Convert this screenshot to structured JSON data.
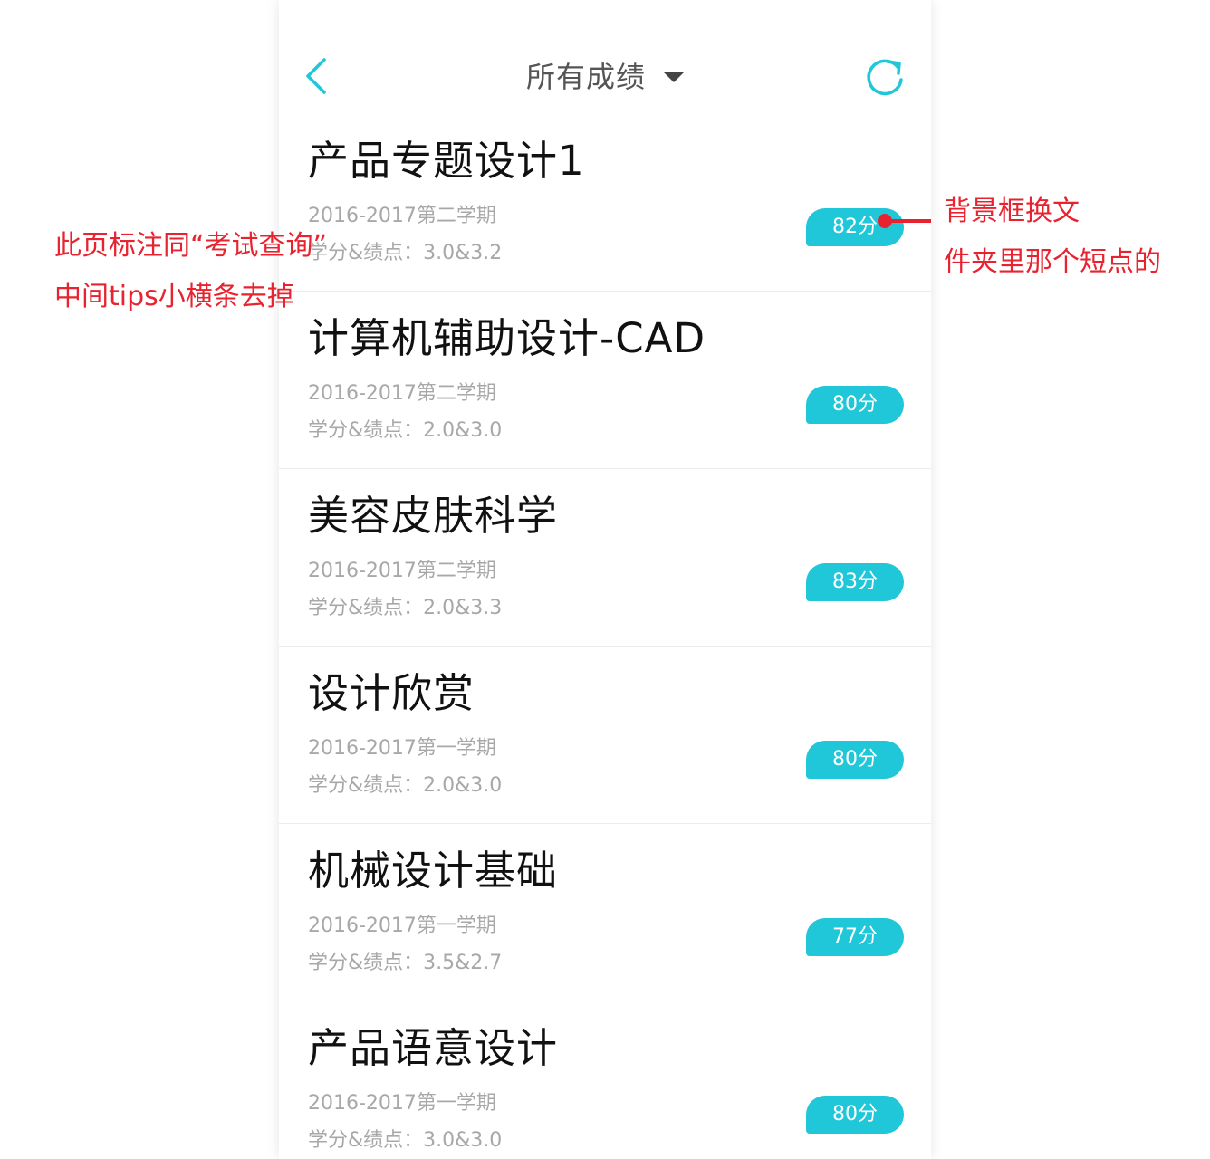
{
  "header": {
    "title": "所有成绩",
    "back_icon": "chevron-left-icon",
    "refresh_icon": "refresh-icon",
    "accent_color": "#1fc7d8"
  },
  "courses": [
    {
      "name": "产品专题设计1",
      "term": "2016-2017第二学期",
      "credit_label": "学分&绩点：",
      "credit_value": "3.0&3.2",
      "score": "82分"
    },
    {
      "name": "计算机辅助设计-CAD",
      "term": "2016-2017第二学期",
      "credit_label": "学分&绩点：",
      "credit_value": "2.0&3.0",
      "score": "80分"
    },
    {
      "name": "美容皮肤科学",
      "term": "2016-2017第二学期",
      "credit_label": "学分&绩点：",
      "credit_value": "2.0&3.3",
      "score": "83分"
    },
    {
      "name": "设计欣赏",
      "term": "2016-2017第一学期",
      "credit_label": "学分&绩点：",
      "credit_value": "2.0&3.0",
      "score": "80分"
    },
    {
      "name": "机械设计基础",
      "term": "2016-2017第一学期",
      "credit_label": "学分&绩点：",
      "credit_value": "3.5&2.7",
      "score": "77分"
    },
    {
      "name": "产品语意设计",
      "term": "2016-2017第一学期",
      "credit_label": "学分&绩点：",
      "credit_value": "3.0&3.0",
      "score": "80分"
    }
  ],
  "annotations": {
    "left": [
      "此页标注同“考试查询”",
      "中间tips小横条去掉"
    ],
    "right": [
      "背景框换文",
      "件夹里那个短点的"
    ],
    "color": "#e8232f"
  }
}
